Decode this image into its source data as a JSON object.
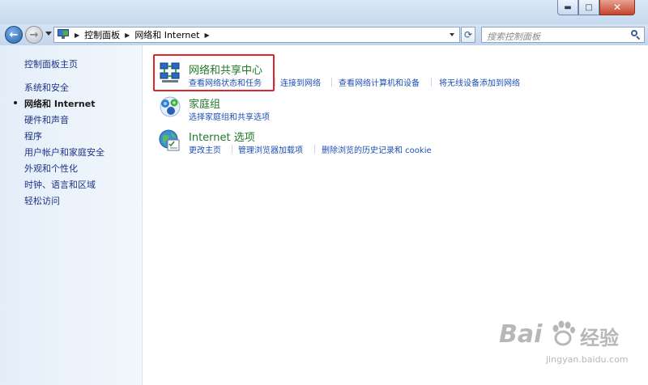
{
  "window": {
    "buttons": {
      "minimize": "▬",
      "maximize": "□",
      "close": "✕"
    }
  },
  "address": {
    "breadcrumbs": [
      "控制面板",
      "网络和 Internet"
    ],
    "search_placeholder": "搜索控制面板"
  },
  "sidebar": {
    "items": [
      {
        "label": "控制面板主页",
        "active": false
      },
      {
        "label": "系统和安全",
        "active": false
      },
      {
        "label": "网络和 Internet",
        "active": true
      },
      {
        "label": "硬件和声音",
        "active": false
      },
      {
        "label": "程序",
        "active": false
      },
      {
        "label": "用户帐户和家庭安全",
        "active": false
      },
      {
        "label": "外观和个性化",
        "active": false
      },
      {
        "label": "时钟、语言和区域",
        "active": false
      },
      {
        "label": "轻松访问",
        "active": false
      }
    ]
  },
  "categories": [
    {
      "title": "网络和共享中心",
      "icon": "network-sharing-center-icon",
      "links": [
        "查看网络状态和任务",
        "连接到网络",
        "查看网络计算机和设备",
        "将无线设备添加到网络"
      ]
    },
    {
      "title": "家庭组",
      "icon": "homegroup-icon",
      "links": [
        "选择家庭组和共享选项"
      ]
    },
    {
      "title": "Internet 选项",
      "icon": "internet-options-icon",
      "links": [
        "更改主页",
        "管理浏览器加载项",
        "删除浏览的历史记录和 cookie"
      ]
    }
  ],
  "watermark": {
    "brand": "Bai",
    "brand_suffix": "经验",
    "url": "jingyan.baidu.com"
  },
  "colors": {
    "link": "#1e4fb3",
    "category_title": "#21792b",
    "highlight_border": "#e0262b",
    "sidebar_text": "#1e3287"
  }
}
